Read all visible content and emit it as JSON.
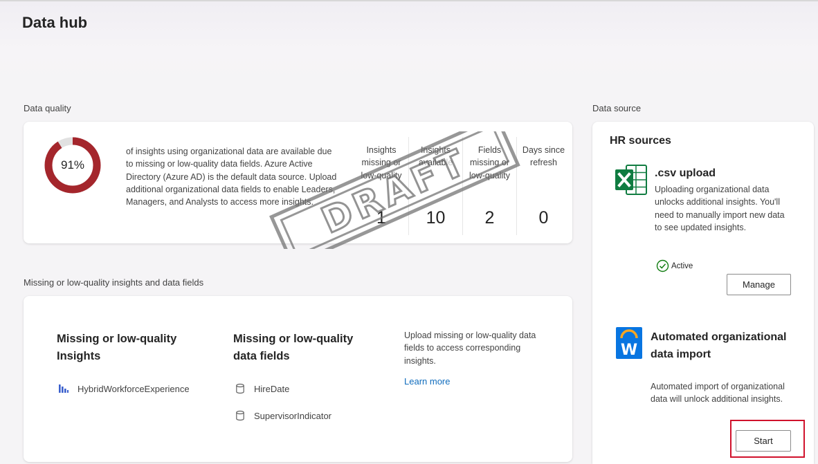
{
  "page": {
    "title": "Data hub"
  },
  "data_quality": {
    "section_label": "Data quality",
    "percent": "91%",
    "percent_value": 0.91,
    "description": "of insights using organizational data are available due to missing or low-quality data fields. Azure Active Directory (Azure AD) is the default data source. Upload additional organizational data fields to enable Leaders, Managers, and Analysts to access more insights.",
    "metrics": [
      {
        "label": "Insights missing or low-quality",
        "value": "1"
      },
      {
        "label": "Insights available",
        "value": "10"
      },
      {
        "label": "Fields missing or low-quality",
        "value": "2"
      },
      {
        "label": "Days since refresh",
        "value": "0"
      }
    ],
    "watermark": "DRAFT"
  },
  "missing": {
    "section_label": "Missing or low-quality insights and data fields",
    "insights_title": "Missing or low-quality Insights",
    "insights": [
      "HybridWorkforceExperience"
    ],
    "fields_title": "Missing or low-quality data fields",
    "fields": [
      "HireDate",
      "SupervisorIndicator"
    ],
    "upload_text": "Upload missing or low-quality data fields to access corresponding insights.",
    "learn_more": "Learn more"
  },
  "data_source": {
    "section_label": "Data source",
    "title": "HR sources",
    "csv": {
      "title": ".csv upload",
      "description": "Uploading organizational data unlocks additional insights. You'll need to manually import new data to see updated insights.",
      "status": "Active",
      "button": "Manage",
      "icon": "excel-icon"
    },
    "auto": {
      "title": "Automated organizational data import",
      "description": "Automated import of organizational data will unlock additional insights.",
      "button": "Start",
      "icon": "workday-icon"
    }
  },
  "colors": {
    "donut_fill": "#a4262c",
    "donut_track": "#e1e1e1",
    "link": "#0f6cbd",
    "excel_green": "#107c41",
    "workday_blue": "#0875e1",
    "active_green": "#107c10",
    "highlight_red": "#d0112b"
  }
}
